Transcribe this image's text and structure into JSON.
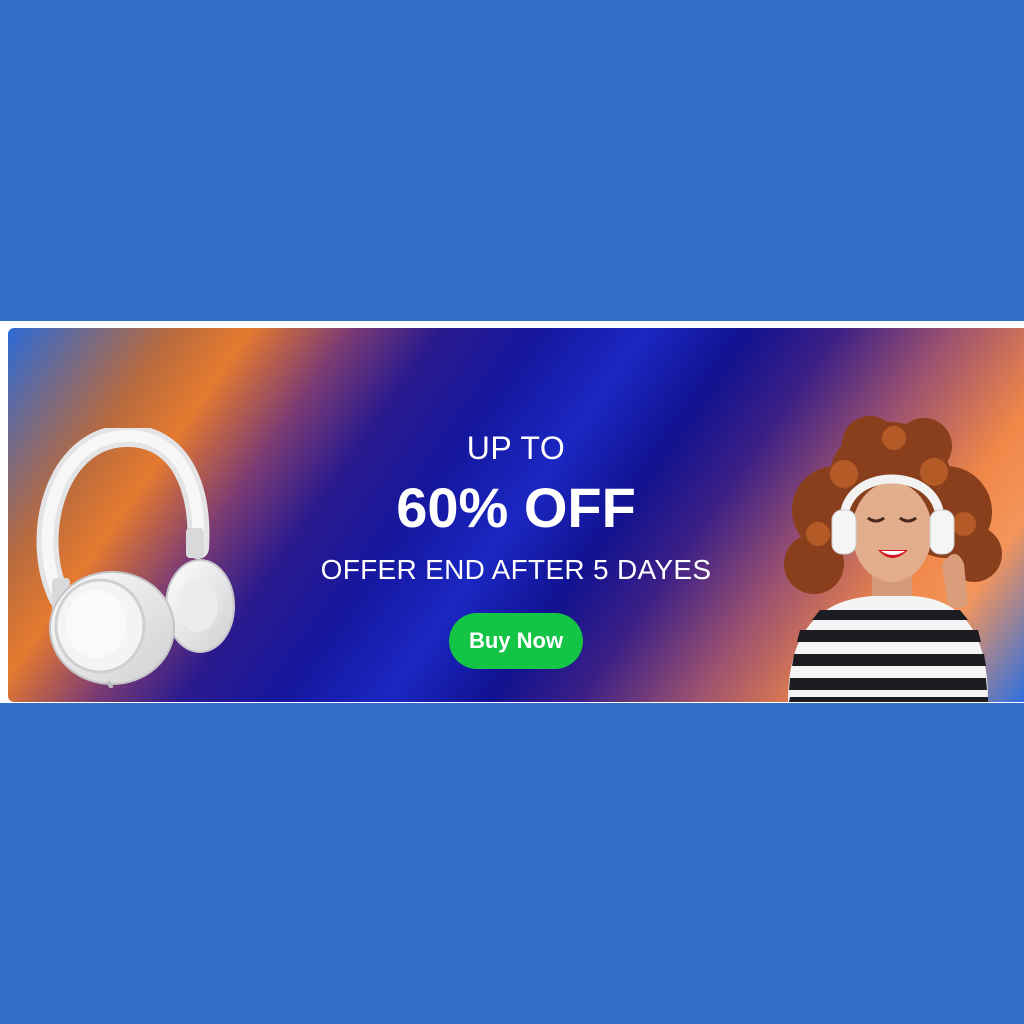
{
  "colors": {
    "page_background": "#356fc9",
    "button_background": "#13c445",
    "text": "#ffffff"
  },
  "banner": {
    "line1": "UP TO",
    "headline": "60% OFF",
    "line3": "OFFER END AFTER 5 DAYES",
    "button_label": "Buy Now"
  },
  "images": {
    "left": "headphones-image",
    "right": "woman-with-headphones-image"
  }
}
